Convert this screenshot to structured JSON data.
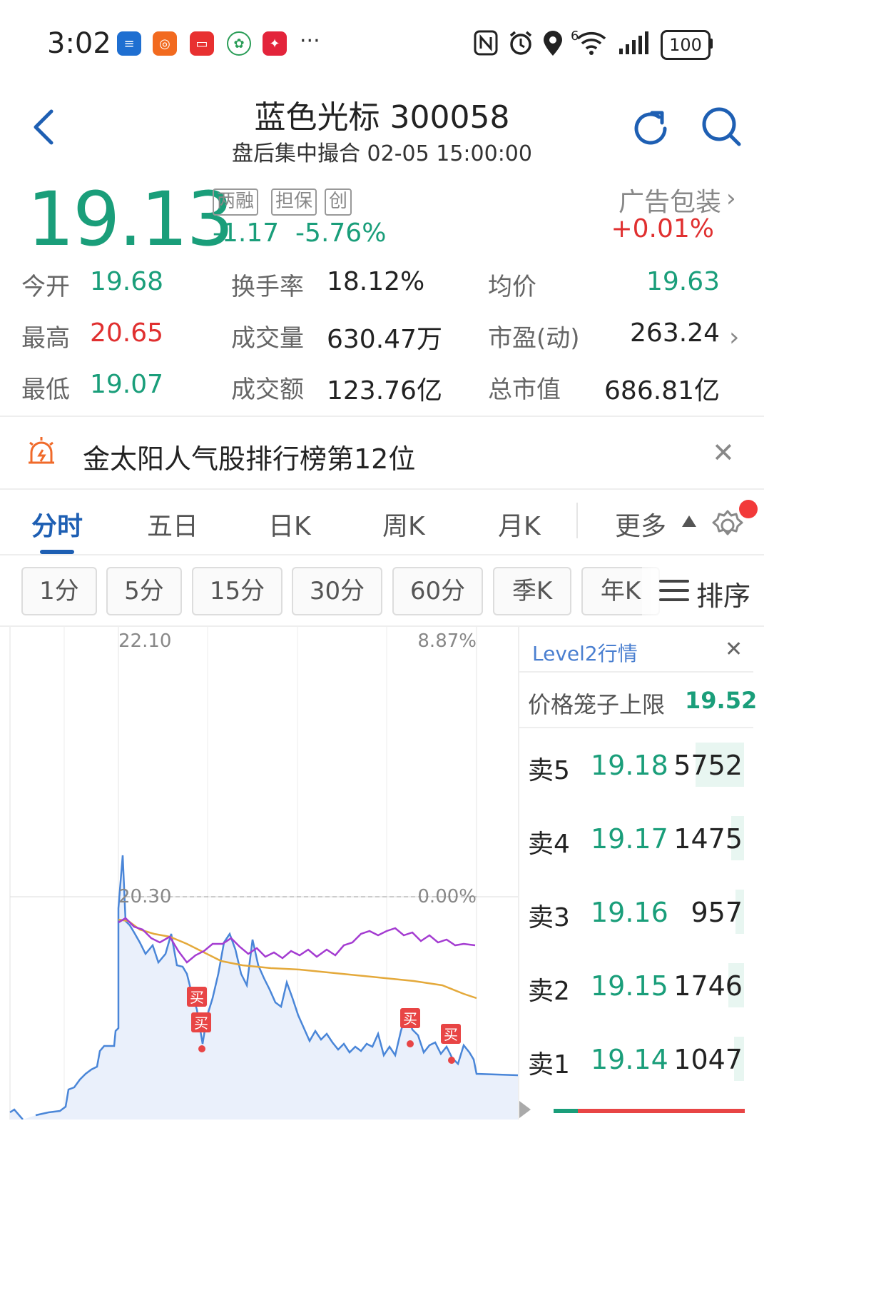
{
  "status_bar": {
    "time": "3:02",
    "battery": "100",
    "signal_sup": "6",
    "overflow": "···"
  },
  "header": {
    "title": "蓝色光标 300058",
    "subtitle": "盘后集中撮合 02-05 15:00:00"
  },
  "quote": {
    "price": "19.13",
    "tags": [
      "两融",
      "担保",
      "创"
    ],
    "change": "-1.17",
    "change_pct": "-5.76%",
    "sector_name": "广告包装",
    "sector_change": "+0.01%"
  },
  "stats": {
    "open_label": "今开",
    "open": "19.68",
    "high_label": "最高",
    "high": "20.65",
    "low_label": "最低",
    "low": "19.07",
    "turnover_label": "换手率",
    "turnover": "18.12%",
    "volume_label": "成交量",
    "volume": "630.47万",
    "amount_label": "成交额",
    "amount": "123.76亿",
    "avg_label": "均价",
    "avg": "19.63",
    "pe_label": "市盈(动)",
    "pe": "263.24",
    "mcap_label": "总市值",
    "mcap": "686.81亿"
  },
  "banner": {
    "text": "金太阳人气股排行榜第12位"
  },
  "tabs": [
    "分时",
    "五日",
    "日K",
    "周K",
    "月K",
    "更多"
  ],
  "periods": [
    "1分",
    "5分",
    "15分",
    "30分",
    "60分",
    "季K",
    "年K"
  ],
  "sort_label": "排序",
  "chart": {
    "top_price": "22.10",
    "top_pct": "8.87%",
    "mid_price": "20.30",
    "mid_pct": "0.00%",
    "buy_marker": "买"
  },
  "level2": {
    "title": "Level2行情",
    "cap_label": "价格笼子上限",
    "cap_value": "19.52",
    "asks": [
      {
        "label": "卖5",
        "price": "19.18",
        "volume": "5752"
      },
      {
        "label": "卖4",
        "price": "19.17",
        "volume": "1475"
      },
      {
        "label": "卖3",
        "price": "19.16",
        "volume": "957"
      },
      {
        "label": "卖2",
        "price": "19.15",
        "volume": "1746"
      },
      {
        "label": "卖1",
        "price": "19.14",
        "volume": "1047"
      }
    ]
  },
  "colors": {
    "down": "#1a9e7a",
    "up": "#e03030",
    "accent": "#1e5fb3"
  }
}
